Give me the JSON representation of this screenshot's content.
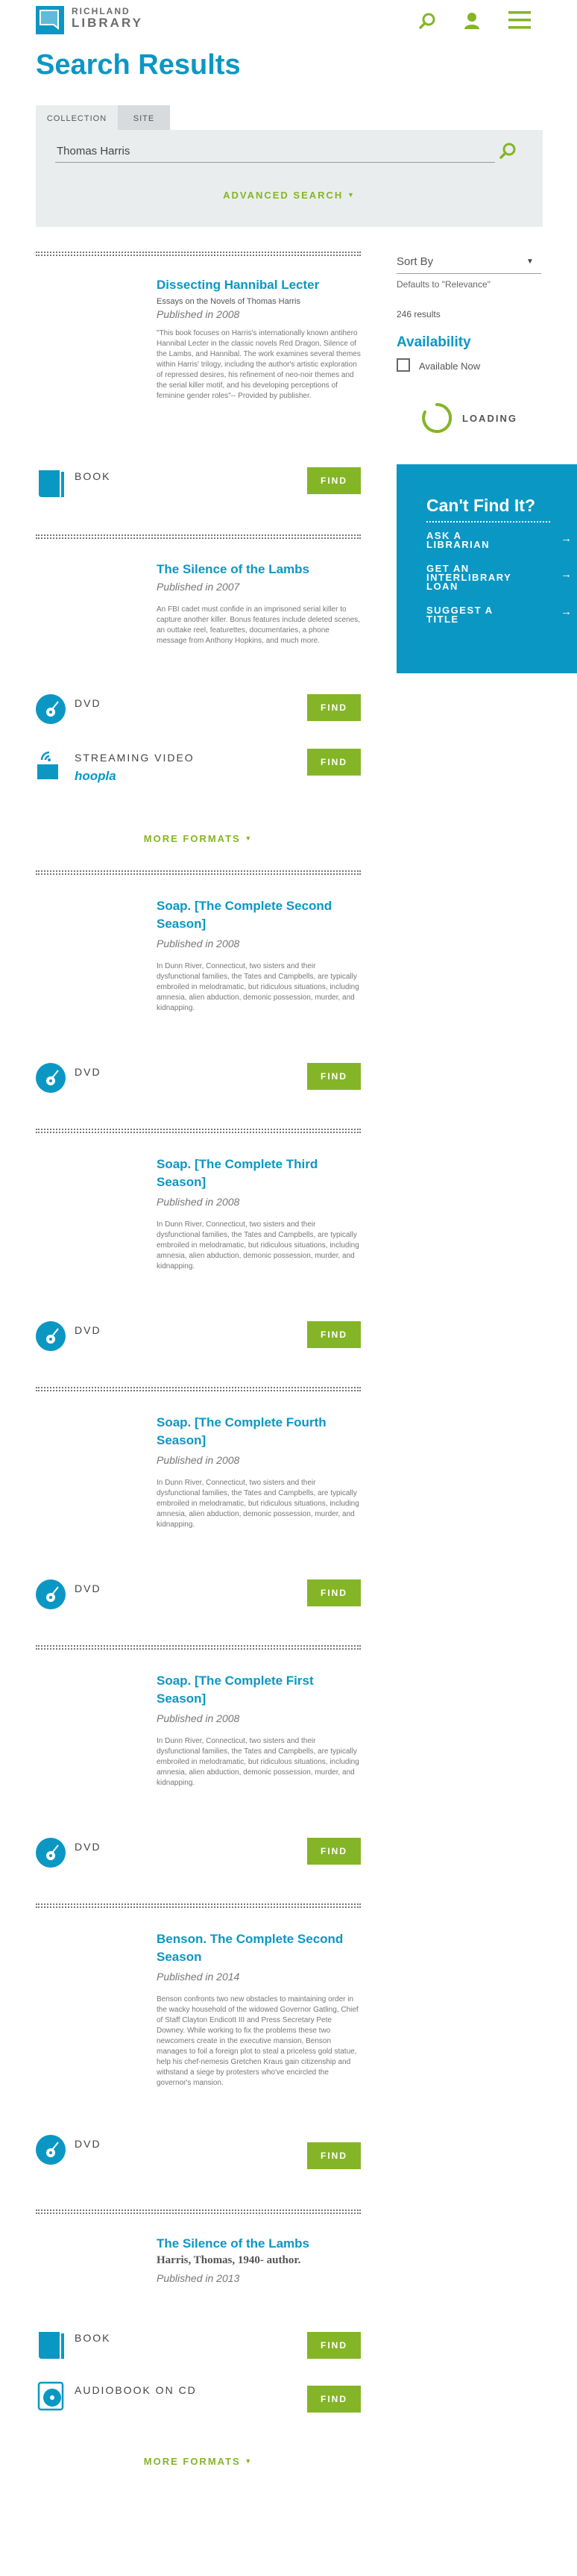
{
  "header": {
    "logo_line1": "RICHLAND",
    "logo_line2": "LIBRARY",
    "icons": [
      "search-icon",
      "user-icon",
      "menu-icon"
    ]
  },
  "page_title": "Search Results",
  "search": {
    "tabs": [
      "COLLECTION",
      "SITE"
    ],
    "active_tab": "COLLECTION",
    "query": "Thomas Harris",
    "advanced_label": "ADVANCED SEARCH"
  },
  "sidebar": {
    "sort_label": "Sort By",
    "sort_default": "Defaults to \"Relevance\"",
    "results_count": "246 results",
    "availability_heading": "Availability",
    "available_now": "Available Now",
    "loading": "LOADING",
    "cant_find": {
      "heading": "Can't Find It?",
      "items": [
        "ASK A LIBRARIAN",
        "GET AN INTERLIBRARY LOAN",
        "SUGGEST A TITLE"
      ]
    }
  },
  "find_label": "FIND",
  "more_formats_label": "MORE FORMATS",
  "results": [
    {
      "title": "Dissecting Hannibal Lecter",
      "subtitle": "Essays on the Novels of Thomas Harris",
      "published": "Published in 2008",
      "description": "\"This book focuses on Harris's internationally known antihero Hannibal Lecter in the classic novels Red Dragon, Silence of the Lambs, and Hannibal. The work examines several themes within Harris' trilogy, including the author's artistic exploration of repressed desires, his refinement of neo-noir themes and the serial killer motif, and his developing perceptions of feminine gender roles\"-- Provided by publisher.",
      "formats": [
        "BOOK"
      ]
    },
    {
      "title": "The Silence of the Lambs",
      "published": "Published in 2007",
      "description": "An FBI cadet must confide in an imprisoned serial killer to capture another killer. Bonus features include deleted scenes, an outtake reel, featurettes, documentaries, a phone message from Anthony Hopkins, and much more.",
      "formats": [
        "DVD",
        "STREAMING VIDEO"
      ],
      "streaming_provider": "hoopla"
    },
    {
      "title": "Soap. [The Complete Second Season]",
      "published": "Published in 2008",
      "description": "In Dunn River, Connecticut, two sisters and their dysfunctional families, the Tates and Campbells, are typically embroiled in melodramatic, but ridiculous situations, including amnesia, alien abduction, demonic possession, murder, and kidnapping.",
      "formats": [
        "DVD"
      ]
    },
    {
      "title": "Soap. [The Complete Third Season]",
      "published": "Published in 2008",
      "description": "In Dunn River, Connecticut, two sisters and their dysfunctional families, the Tates and Campbells, are typically embroiled in melodramatic, but ridiculous situations, including amnesia, alien abduction, demonic possession, murder, and kidnapping.",
      "formats": [
        "DVD"
      ]
    },
    {
      "title": "Soap. [The Complete Fourth Season]",
      "published": "Published in 2008",
      "description": "In Dunn River, Connecticut, two sisters and their dysfunctional families, the Tates and Campbells, are typically embroiled in melodramatic, but ridiculous situations, including amnesia, alien abduction, demonic possession, murder, and kidnapping.",
      "formats": [
        "DVD"
      ]
    },
    {
      "title": "Soap. [The Complete First Season]",
      "published": "Published in 2008",
      "description": "In Dunn River, Connecticut, two sisters and their dysfunctional families, the Tates and Campbells, are typically embroiled in melodramatic, but ridiculous situations, including amnesia, alien abduction, demonic possession, murder, and kidnapping.",
      "formats": [
        "DVD"
      ]
    },
    {
      "title": "Benson. The Complete Second Season",
      "published": "Published in 2014",
      "description": "Benson confronts two new obstacles to maintaining order in the wacky household of the widowed Governor Gatling, Chief of Staff Clayton Endicott III and Press Secretary Pete Downey. While working to fix the problems these two newcomers create in the executive mansion, Benson manages to foil a foreign plot to steal a priceless gold statue, help his chef-nemesis Gretchen Kraus gain citizenship and withstand a siege by protesters who've encircled the governor's mansion.",
      "formats": [
        "DVD"
      ]
    },
    {
      "title": "The Silence of the Lambs",
      "author": "Harris, Thomas, 1940- author.",
      "published": "Published in 2013",
      "formats": [
        "BOOK",
        "AUDIOBOOK ON CD"
      ]
    }
  ],
  "colors": {
    "teal": "#0b97c4",
    "green": "#84b526",
    "panel": "#eaedee"
  }
}
